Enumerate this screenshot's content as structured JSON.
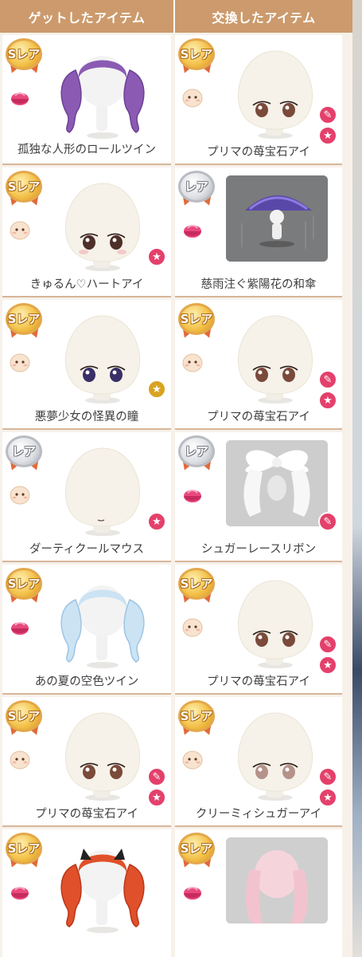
{
  "header": {
    "left_title": "ゲットしたアイテム",
    "right_title": "交換したアイテム"
  },
  "colors": {
    "header_bg": "#cc9a6c",
    "pink_badge": "#e4406b",
    "gold_badge": "#d8a320"
  },
  "rows": [
    {
      "left": {
        "rarity": "Sレア",
        "medal": "gold",
        "category": "hair",
        "art": "purple-twin-drill-hair",
        "badges": [],
        "name": "孤独な人形のロールツイン"
      },
      "right": {
        "rarity": "Sレア",
        "medal": "gold",
        "category": "face",
        "art": "brown-eyes-face",
        "badges": [
          "brush-icon",
          "star-icon"
        ],
        "name": "プリマの苺宝石アイ"
      }
    },
    {
      "left": {
        "rarity": "Sレア",
        "medal": "gold",
        "category": "face",
        "art": "heart-eyes-face",
        "badges": [
          "star-icon"
        ],
        "name": "きゅるん♡ハートアイ"
      },
      "right": {
        "rarity": "レア",
        "medal": "silver",
        "category": "hair",
        "art": "purple-umbrella-scene",
        "badges": [],
        "name": "慈雨注ぐ紫陽花の和傘"
      }
    },
    {
      "left": {
        "rarity": "Sレア",
        "medal": "gold",
        "category": "face",
        "art": "dark-purple-eyes-face",
        "badges": [
          "gold-star-icon"
        ],
        "name": "悪夢少女の怪異の瞳"
      },
      "right": {
        "rarity": "Sレア",
        "medal": "gold",
        "category": "face",
        "art": "brown-eyes-face",
        "badges": [
          "brush-icon",
          "star-icon"
        ],
        "name": "プリマの苺宝石アイ"
      }
    },
    {
      "left": {
        "rarity": "レア",
        "medal": "silver",
        "category": "face",
        "art": "mouth-only-face",
        "badges": [
          "star-icon"
        ],
        "name": "ダーティクールマウス"
      },
      "right": {
        "rarity": "レア",
        "medal": "silver",
        "category": "hair",
        "art": "white-lace-ribbon",
        "badges": [
          "brush-icon"
        ],
        "name": "シュガーレースリボン"
      }
    },
    {
      "left": {
        "rarity": "Sレア",
        "medal": "gold",
        "category": "hair",
        "art": "pastel-twin-tails",
        "badges": [],
        "name": "あの夏の空色ツイン"
      },
      "right": {
        "rarity": "Sレア",
        "medal": "gold",
        "category": "face",
        "art": "brown-eyes-face",
        "badges": [
          "brush-icon",
          "star-icon"
        ],
        "name": "プリマの苺宝石アイ"
      }
    },
    {
      "left": {
        "rarity": "Sレア",
        "medal": "gold",
        "category": "face",
        "art": "brown-eyes-face",
        "badges": [
          "brush-icon",
          "star-icon"
        ],
        "name": "プリマの苺宝石アイ"
      },
      "right": {
        "rarity": "Sレア",
        "medal": "gold",
        "category": "face",
        "art": "pale-eyes-face",
        "badges": [
          "brush-icon",
          "star-icon"
        ],
        "name": "クリーミィシュガーアイ"
      }
    },
    {
      "left": {
        "rarity": "Sレア",
        "medal": "gold",
        "category": "hair",
        "art": "red-twin-buns",
        "badges": [],
        "name": ""
      },
      "right": {
        "rarity": "Sレア",
        "medal": "gold",
        "category": "hair",
        "art": "pink-long-hair",
        "badges": [],
        "name": ""
      }
    }
  ]
}
